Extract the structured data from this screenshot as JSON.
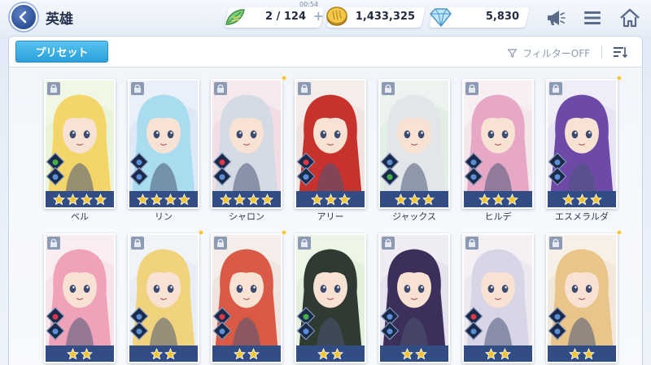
{
  "header": {
    "title": "英雄",
    "back_icon": "back-arrow-icon"
  },
  "resources": {
    "stamina": {
      "value": "2 / 124",
      "timer": "00:54",
      "icon": "stamina-leaf-icon"
    },
    "gold": {
      "value": "1,433,325",
      "icon": "gold-coin-icon"
    },
    "gems": {
      "value": "5,830",
      "icon": "gem-icon"
    }
  },
  "toolbar_icons": {
    "announce": "megaphone-icon",
    "menu": "menu-icon",
    "home": "home-icon"
  },
  "toolbar": {
    "preset_label": "プリセット",
    "filter_label": "フィルターOFF",
    "sort_icon": "sort-icon"
  },
  "colors": {
    "accent": "#2aa0dc",
    "star": "#f5c430",
    "star_bar": "#324d83",
    "back_button": "#2d4f93"
  },
  "heroes": [
    {
      "name": "ベル",
      "stars": 4,
      "new": false,
      "hair": "#f3d56a",
      "bg": "#e9f4d8",
      "c1": "#43b04a",
      "c2": "#5a8fd6"
    },
    {
      "name": "リン",
      "stars": 4,
      "new": false,
      "hair": "#a9dcef",
      "bg": "#dde9f6",
      "c1": "#5a8fd6",
      "c2": "#5a8fd6"
    },
    {
      "name": "シャロン",
      "stars": 4,
      "new": true,
      "hair": "#d5dbe4",
      "bg": "#f1dde3",
      "c1": "#d9384b",
      "c2": "#5a8fd6"
    },
    {
      "name": "アリー",
      "stars": 3,
      "new": false,
      "hair": "#c8322d",
      "bg": "#efe4df",
      "c1": "#d9384b",
      "c2": "#5a8fd6"
    },
    {
      "name": "ジャックス",
      "stars": 3,
      "new": false,
      "hair": "#e3e6e8",
      "bg": "#e3efe6",
      "c1": "#5a8fd6",
      "c2": "#43b04a"
    },
    {
      "name": "ヒルデ",
      "stars": 3,
      "new": false,
      "hair": "#e7a8c5",
      "bg": "#f3e6ec",
      "c1": "#5a8fd6",
      "c2": "#5a8fd6"
    },
    {
      "name": "エスメラルダ",
      "stars": 3,
      "new": true,
      "hair": "#6e4aa8",
      "bg": "#e7e4f3",
      "c1": "#5a8fd6",
      "c2": "#5a8fd6"
    },
    {
      "name": "",
      "stars": 2,
      "new": false,
      "hair": "#f0a2b8",
      "bg": "#f6e4ea",
      "c1": "#d9384b",
      "c2": "#5a8fd6"
    },
    {
      "name": "",
      "stars": 2,
      "new": true,
      "hair": "#f2d37d",
      "bg": "#e9eef6",
      "c1": "#5a8fd6",
      "c2": "#5a8fd6"
    },
    {
      "name": "",
      "stars": 2,
      "new": true,
      "hair": "#d95a46",
      "bg": "#efe4de",
      "c1": "#d9384b",
      "c2": "#5a8fd6"
    },
    {
      "name": "",
      "stars": 2,
      "new": false,
      "hair": "#2f3a32",
      "bg": "#e4f0db",
      "c1": "#43b04a",
      "c2": "#5a8fd6"
    },
    {
      "name": "",
      "stars": 2,
      "new": false,
      "hair": "#3c2f5a",
      "bg": "#e6e2ef",
      "c1": "#5a8fd6",
      "c2": "#5a8fd6"
    },
    {
      "name": "",
      "stars": 2,
      "new": false,
      "hair": "#d8d6e6",
      "bg": "#eee8ef",
      "c1": "#d9384b",
      "c2": "#5a8fd6"
    },
    {
      "name": "",
      "stars": 2,
      "new": true,
      "hair": "#e9c58a",
      "bg": "#f1e8db",
      "c1": "#5a8fd6",
      "c2": "#5a8fd6"
    }
  ]
}
